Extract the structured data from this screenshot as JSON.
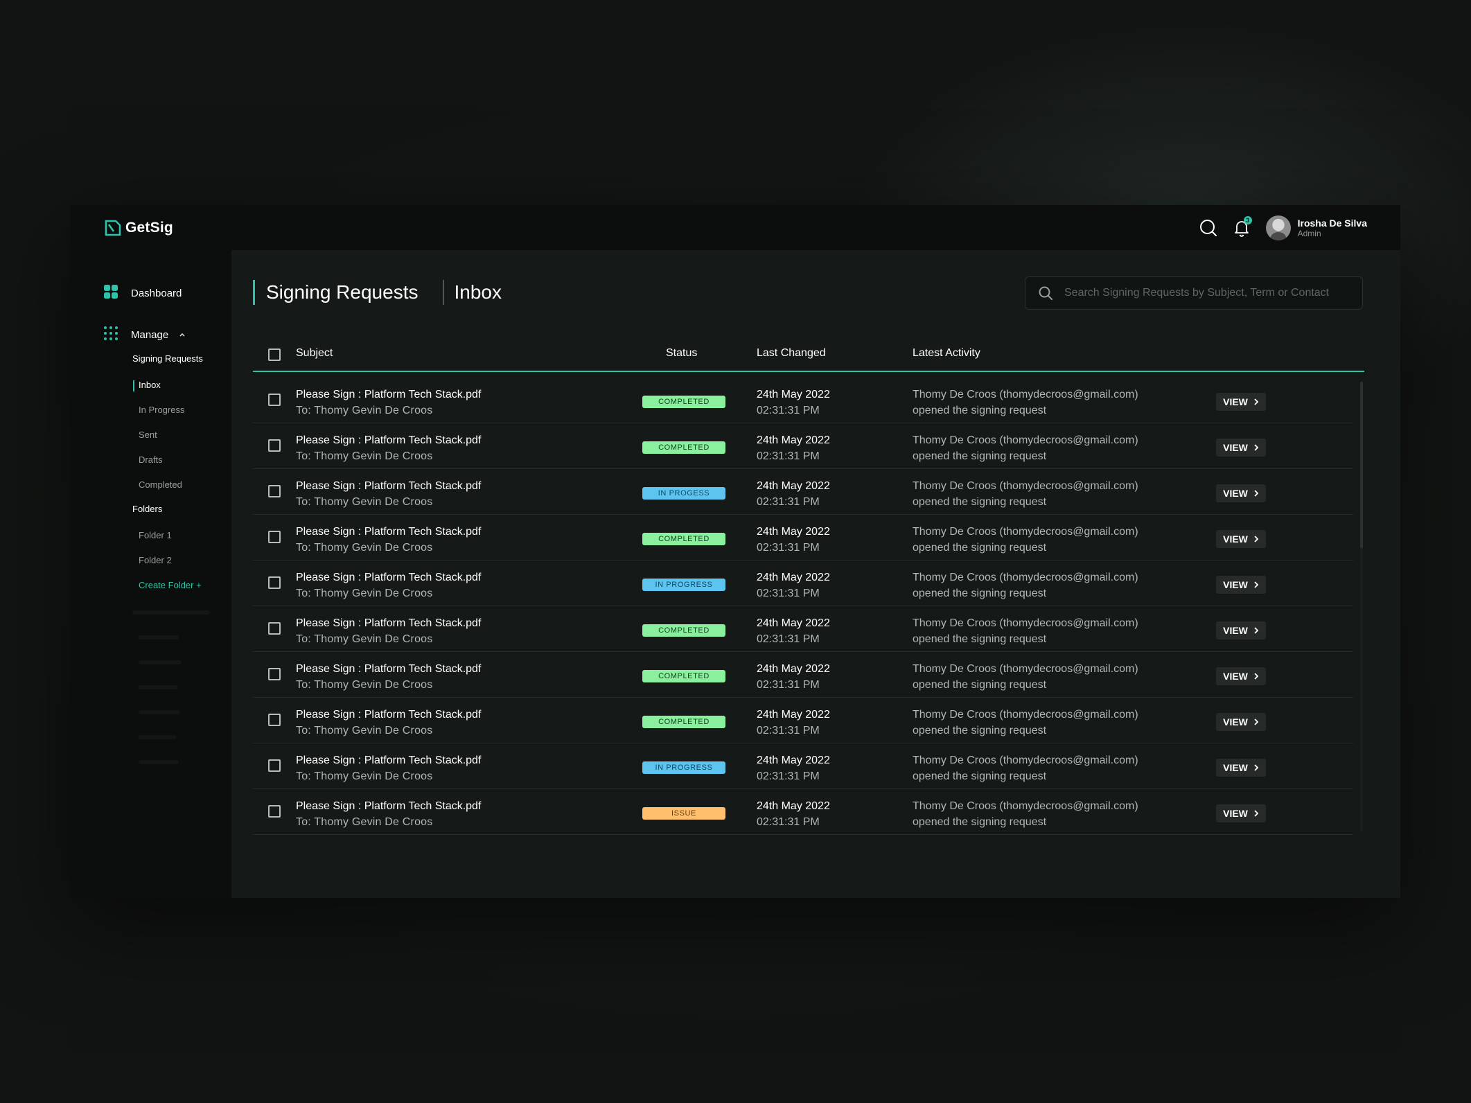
{
  "brand": {
    "name": "GetSig",
    "accent": "#2ec4a9"
  },
  "topbar": {
    "notifications_count": "3",
    "user": {
      "name": "Irosha De Silva",
      "role": "Admin"
    }
  },
  "sidebar": {
    "dashboard": "Dashboard",
    "manage": "Manage",
    "signing_requests": "Signing Requests",
    "items": [
      "Inbox",
      "In Progress",
      "Sent",
      "Drafts",
      "Completed"
    ],
    "folders_heading": "Folders",
    "folders": [
      "Folder 1",
      "Folder 2"
    ],
    "create_folder": "Create Folder +"
  },
  "header": {
    "title": "Signing Requests",
    "section": "Inbox",
    "search_placeholder": "Search Signing Requests by Subject, Term or Contact"
  },
  "table": {
    "columns": {
      "subject": "Subject",
      "status": "Status",
      "last_changed": "Last Changed",
      "latest_activity": "Latest Activity"
    },
    "view_label": "VIEW",
    "rows": [
      {
        "subject": "Please Sign : Platform Tech Stack.pdf",
        "to": "To: Thomy Gevin De Croos",
        "status": "COMPLETED",
        "status_kind": "completed",
        "date": "24th May 2022",
        "time": "02:31:31 PM",
        "activity": "Thomy De Croos (thomydecroos@gmail.com)",
        "activity2": "opened the signing request"
      },
      {
        "subject": "Please Sign : Platform Tech Stack.pdf",
        "to": "To: Thomy Gevin De Croos",
        "status": "COMPLETED",
        "status_kind": "completed",
        "date": "24th May 2022",
        "time": "02:31:31 PM",
        "activity": "Thomy De Croos (thomydecroos@gmail.com)",
        "activity2": "opened the signing request"
      },
      {
        "subject": "Please Sign : Platform Tech Stack.pdf",
        "to": "To: Thomy Gevin De Croos",
        "status": "IN PROGESS",
        "status_kind": "inprogress",
        "date": "24th May 2022",
        "time": "02:31:31 PM",
        "activity": "Thomy De Croos (thomydecroos@gmail.com)",
        "activity2": "opened the signing request"
      },
      {
        "subject": "Please Sign : Platform Tech Stack.pdf",
        "to": "To: Thomy Gevin De Croos",
        "status": "COMPLETED",
        "status_kind": "completed",
        "date": "24th May 2022",
        "time": "02:31:31 PM",
        "activity": "Thomy De Croos (thomydecroos@gmail.com)",
        "activity2": "opened the signing request"
      },
      {
        "subject": "Please Sign : Platform Tech Stack.pdf",
        "to": "To: Thomy Gevin De Croos",
        "status": "IN PROGRESS",
        "status_kind": "inprogress",
        "date": "24th May 2022",
        "time": "02:31:31 PM",
        "activity": "Thomy De Croos (thomydecroos@gmail.com)",
        "activity2": "opened the signing request"
      },
      {
        "subject": "Please Sign : Platform Tech Stack.pdf",
        "to": "To: Thomy Gevin De Croos",
        "status": "COMPLETED",
        "status_kind": "completed",
        "date": "24th May 2022",
        "time": "02:31:31 PM",
        "activity": "Thomy De Croos (thomydecroos@gmail.com)",
        "activity2": "opened the signing request"
      },
      {
        "subject": "Please Sign : Platform Tech Stack.pdf",
        "to": "To: Thomy Gevin De Croos",
        "status": "COMPLETED",
        "status_kind": "completed",
        "date": "24th May 2022",
        "time": "02:31:31 PM",
        "activity": "Thomy De Croos (thomydecroos@gmail.com)",
        "activity2": "opened the signing request"
      },
      {
        "subject": "Please Sign : Platform Tech Stack.pdf",
        "to": "To: Thomy Gevin De Croos",
        "status": "COMPLETED",
        "status_kind": "completed",
        "date": "24th May 2022",
        "time": "02:31:31 PM",
        "activity": "Thomy De Croos (thomydecroos@gmail.com)",
        "activity2": "opened the signing request"
      },
      {
        "subject": "Please Sign : Platform Tech Stack.pdf",
        "to": "To: Thomy Gevin De Croos",
        "status": "IN PROGRESS",
        "status_kind": "inprogress",
        "date": "24th May 2022",
        "time": "02:31:31 PM",
        "activity": "Thomy De Croos (thomydecroos@gmail.com)",
        "activity2": "opened the signing request"
      },
      {
        "subject": "Please Sign : Platform Tech Stack.pdf",
        "to": "To: Thomy Gevin De Croos",
        "status": "ISSUE",
        "status_kind": "issue",
        "date": "24th May 2022",
        "time": "02:31:31 PM",
        "activity": "Thomy De Croos (thomydecroos@gmail.com)",
        "activity2": "opened the signing request"
      }
    ]
  },
  "colors": {
    "completed": "#8af09d",
    "in_progress": "#5cc4ef",
    "issue": "#ffbf6b",
    "background": "#151918",
    "sidebar": "#0c0e0e"
  },
  "icons": [
    "logo-icon",
    "search-icon",
    "bell-icon",
    "dashboard-icon",
    "manage-icon",
    "chevron-up-icon",
    "chevron-right-icon",
    "checkbox-icon"
  ]
}
